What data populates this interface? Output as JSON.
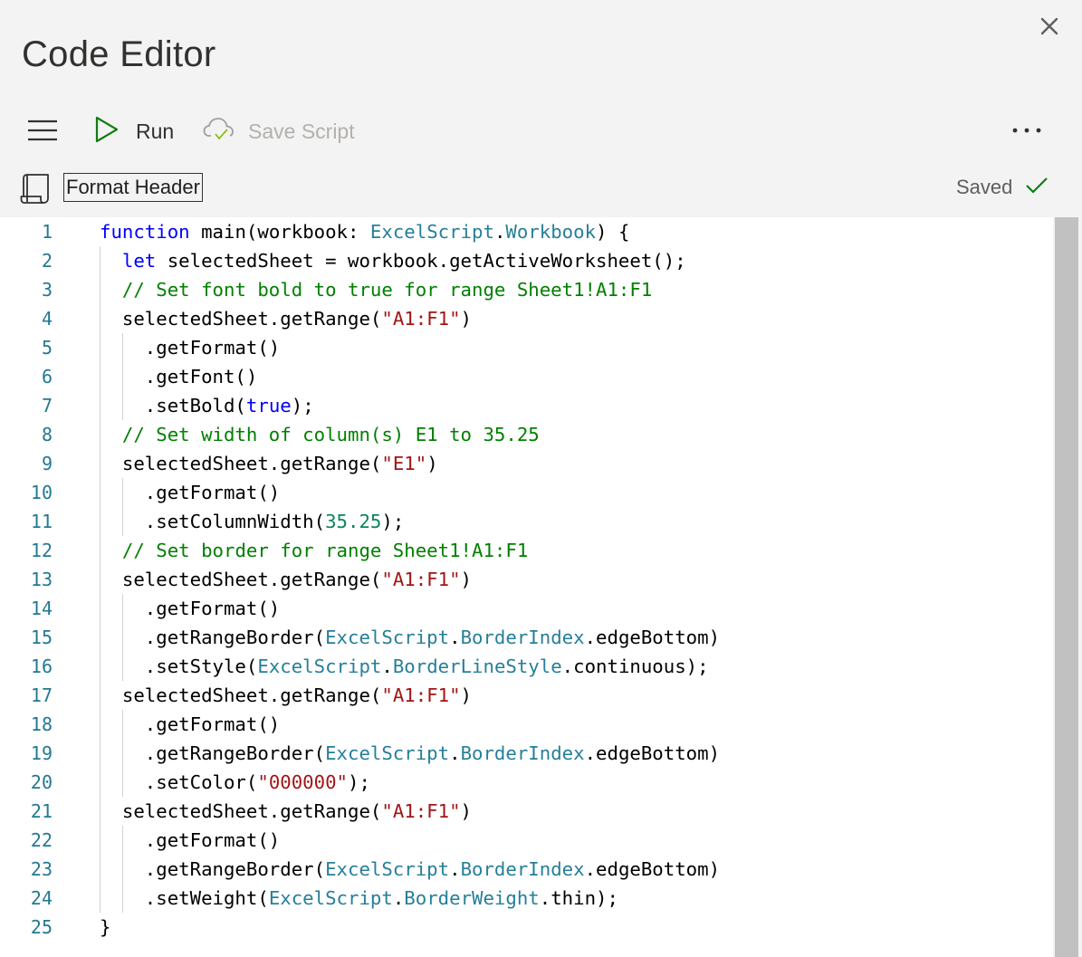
{
  "header": {
    "title": "Code Editor",
    "close_icon": "close-icon"
  },
  "toolbar": {
    "menu_icon": "hamburger-menu-icon",
    "run_label": "Run",
    "run_icon": "play-icon",
    "save_label": "Save Script",
    "save_icon": "cloud-check-icon",
    "save_enabled": false,
    "more_icon": "more-horizontal-icon"
  },
  "script": {
    "icon": "script-document-icon",
    "name": "Format Header",
    "status": "Saved",
    "status_icon": "checkmark-icon"
  },
  "colors": {
    "accent_green": "#107c10",
    "keyword": "#0000ff",
    "type": "#267f99",
    "string": "#a31515",
    "comment": "#008000",
    "number": "#098658",
    "line_number": "#237893"
  },
  "editor": {
    "lines": [
      {
        "n": "1",
        "indent": 0,
        "tokens": [
          [
            "function",
            "kw"
          ],
          [
            " main(workbook: ",
            ""
          ],
          [
            "ExcelScript",
            "type"
          ],
          [
            ".",
            ""
          ],
          [
            "Workbook",
            "type"
          ],
          [
            ") {",
            ""
          ]
        ]
      },
      {
        "n": "2",
        "indent": 1,
        "tokens": [
          [
            "let",
            "kw"
          ],
          [
            " selectedSheet = workbook.getActiveWorksheet();",
            ""
          ]
        ]
      },
      {
        "n": "3",
        "indent": 1,
        "tokens": [
          [
            "// Set font bold to true for range Sheet1!A1:F1",
            "com"
          ]
        ]
      },
      {
        "n": "4",
        "indent": 1,
        "tokens": [
          [
            "selectedSheet.getRange(",
            ""
          ],
          [
            "\"A1:F1\"",
            "str"
          ],
          [
            ")",
            ""
          ]
        ]
      },
      {
        "n": "5",
        "indent": 2,
        "tokens": [
          [
            ".getFormat()",
            ""
          ]
        ]
      },
      {
        "n": "6",
        "indent": 2,
        "tokens": [
          [
            ".getFont()",
            ""
          ]
        ]
      },
      {
        "n": "7",
        "indent": 2,
        "tokens": [
          [
            ".setBold(",
            ""
          ],
          [
            "true",
            "kw"
          ],
          [
            ");",
            ""
          ]
        ]
      },
      {
        "n": "8",
        "indent": 1,
        "tokens": [
          [
            "// Set width of column(s) E1 to 35.25",
            "com"
          ]
        ]
      },
      {
        "n": "9",
        "indent": 1,
        "tokens": [
          [
            "selectedSheet.getRange(",
            ""
          ],
          [
            "\"E1\"",
            "str"
          ],
          [
            ")",
            ""
          ]
        ]
      },
      {
        "n": "10",
        "indent": 2,
        "tokens": [
          [
            ".getFormat()",
            ""
          ]
        ]
      },
      {
        "n": "11",
        "indent": 2,
        "tokens": [
          [
            ".setColumnWidth(",
            ""
          ],
          [
            "35.25",
            "num"
          ],
          [
            ");",
            ""
          ]
        ]
      },
      {
        "n": "12",
        "indent": 1,
        "tokens": [
          [
            "// Set border for range Sheet1!A1:F1",
            "com"
          ]
        ]
      },
      {
        "n": "13",
        "indent": 1,
        "tokens": [
          [
            "selectedSheet.getRange(",
            ""
          ],
          [
            "\"A1:F1\"",
            "str"
          ],
          [
            ")",
            ""
          ]
        ]
      },
      {
        "n": "14",
        "indent": 2,
        "tokens": [
          [
            ".getFormat()",
            ""
          ]
        ]
      },
      {
        "n": "15",
        "indent": 2,
        "tokens": [
          [
            ".getRangeBorder(",
            ""
          ],
          [
            "ExcelScript",
            "type"
          ],
          [
            ".",
            ""
          ],
          [
            "BorderIndex",
            "type"
          ],
          [
            ".edgeBottom)",
            ""
          ]
        ]
      },
      {
        "n": "16",
        "indent": 2,
        "tokens": [
          [
            ".setStyle(",
            ""
          ],
          [
            "ExcelScript",
            "type"
          ],
          [
            ".",
            ""
          ],
          [
            "BorderLineStyle",
            "type"
          ],
          [
            ".continuous);",
            ""
          ]
        ]
      },
      {
        "n": "17",
        "indent": 1,
        "tokens": [
          [
            "selectedSheet.getRange(",
            ""
          ],
          [
            "\"A1:F1\"",
            "str"
          ],
          [
            ")",
            ""
          ]
        ]
      },
      {
        "n": "18",
        "indent": 2,
        "tokens": [
          [
            ".getFormat()",
            ""
          ]
        ]
      },
      {
        "n": "19",
        "indent": 2,
        "tokens": [
          [
            ".getRangeBorder(",
            ""
          ],
          [
            "ExcelScript",
            "type"
          ],
          [
            ".",
            ""
          ],
          [
            "BorderIndex",
            "type"
          ],
          [
            ".edgeBottom)",
            ""
          ]
        ]
      },
      {
        "n": "20",
        "indent": 2,
        "tokens": [
          [
            ".setColor(",
            ""
          ],
          [
            "\"000000\"",
            "str"
          ],
          [
            ");",
            ""
          ]
        ]
      },
      {
        "n": "21",
        "indent": 1,
        "tokens": [
          [
            "selectedSheet.getRange(",
            ""
          ],
          [
            "\"A1:F1\"",
            "str"
          ],
          [
            ")",
            ""
          ]
        ]
      },
      {
        "n": "22",
        "indent": 2,
        "tokens": [
          [
            ".getFormat()",
            ""
          ]
        ]
      },
      {
        "n": "23",
        "indent": 2,
        "tokens": [
          [
            ".getRangeBorder(",
            ""
          ],
          [
            "ExcelScript",
            "type"
          ],
          [
            ".",
            ""
          ],
          [
            "BorderIndex",
            "type"
          ],
          [
            ".edgeBottom)",
            ""
          ]
        ]
      },
      {
        "n": "24",
        "indent": 2,
        "tokens": [
          [
            ".setWeight(",
            ""
          ],
          [
            "ExcelScript",
            "type"
          ],
          [
            ".",
            ""
          ],
          [
            "BorderWeight",
            "type"
          ],
          [
            ".thin);",
            ""
          ]
        ]
      },
      {
        "n": "25",
        "indent": 0,
        "tokens": [
          [
            "}",
            ""
          ]
        ]
      }
    ]
  }
}
